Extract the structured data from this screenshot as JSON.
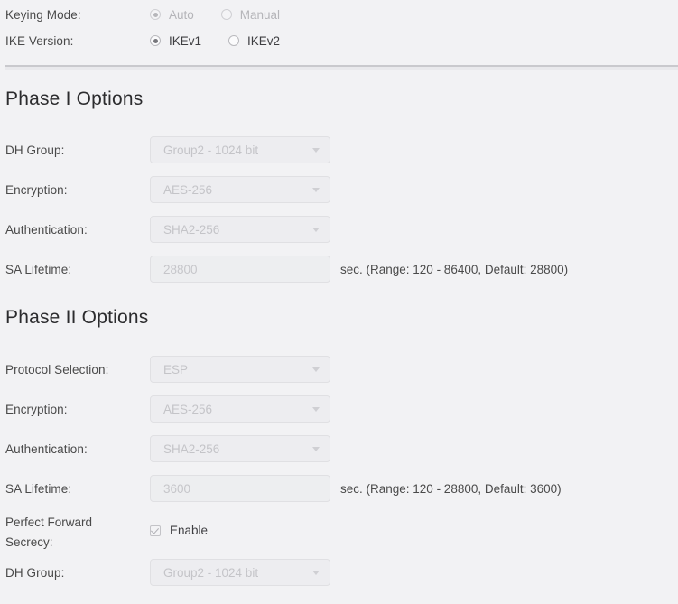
{
  "top": {
    "keying_mode": {
      "label": "Keying Mode:",
      "options": [
        {
          "label": "Auto",
          "selected": true
        },
        {
          "label": "Manual",
          "selected": false
        }
      ]
    },
    "ike_version": {
      "label": "IKE Version:",
      "options": [
        {
          "label": "IKEv1",
          "selected": true
        },
        {
          "label": "IKEv2",
          "selected": false
        }
      ]
    }
  },
  "phase1": {
    "heading": "Phase I Options",
    "dh_group": {
      "label": "DH Group:",
      "value": "Group2 - 1024 bit"
    },
    "encryption": {
      "label": "Encryption:",
      "value": "AES-256"
    },
    "authentication": {
      "label": "Authentication:",
      "value": "SHA2-256"
    },
    "sa_lifetime": {
      "label": "SA Lifetime:",
      "value": "28800",
      "helper": "sec. (Range: 120 - 86400, Default: 28800)"
    }
  },
  "phase2": {
    "heading": "Phase II Options",
    "protocol_selection": {
      "label": "Protocol Selection:",
      "value": "ESP"
    },
    "encryption": {
      "label": "Encryption:",
      "value": "AES-256"
    },
    "authentication": {
      "label": "Authentication:",
      "value": "SHA2-256"
    },
    "sa_lifetime": {
      "label": "SA Lifetime:",
      "value": "3600",
      "helper": "sec. (Range: 120 - 28800, Default: 3600)"
    },
    "pfs": {
      "label": "Perfect Forward\nSecrecy:",
      "checkbox_label": "Enable",
      "checked": true
    },
    "dh_group": {
      "label": "DH Group:",
      "value": "Group2 - 1024 bit"
    }
  },
  "icons": {
    "dropdown_caret": "chevron-down-icon",
    "radio_selected": "radio-selected-icon",
    "radio_unselected": "radio-unselected-icon",
    "checkbox_checked": "checkbox-checked-icon"
  },
  "colors": {
    "background": "#f2f2f4",
    "label_text": "#4a4a4a",
    "disabled_text": "#c4c4c8",
    "control_fill": "#ededf0",
    "control_border": "#e0e0e3",
    "divider": "#c9c9cd",
    "heading_text": "#2c2c2e"
  }
}
